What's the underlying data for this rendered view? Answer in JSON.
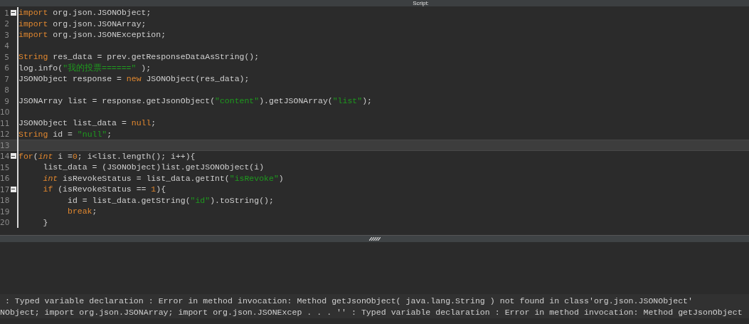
{
  "window": {
    "title": "Script:"
  },
  "editor": {
    "lines": [
      {
        "number": "1",
        "foldable": true,
        "current": false,
        "tokens": [
          {
            "kind": "keyword",
            "text": "import"
          },
          {
            "kind": "plain",
            "text": " org.json.JSONObject;"
          }
        ]
      },
      {
        "number": "2",
        "foldable": false,
        "current": false,
        "tokens": [
          {
            "kind": "keyword",
            "text": "import"
          },
          {
            "kind": "plain",
            "text": " org.json.JSONArray;"
          }
        ]
      },
      {
        "number": "3",
        "foldable": false,
        "current": false,
        "tokens": [
          {
            "kind": "keyword",
            "text": "import"
          },
          {
            "kind": "plain",
            "text": " org.json.JSONException;"
          }
        ]
      },
      {
        "number": "4",
        "foldable": false,
        "current": false
      },
      {
        "number": "5",
        "foldable": false,
        "current": false,
        "tokens": [
          {
            "kind": "keyword",
            "text": "String"
          },
          {
            "kind": "plain",
            "text": " res_data = prev.getResponseDataAsString();"
          }
        ]
      },
      {
        "number": "6",
        "foldable": false,
        "current": false,
        "tokens": [
          {
            "kind": "plain",
            "text": "log.info("
          },
          {
            "kind": "string",
            "text": "\"我的投票======\""
          },
          {
            "kind": "plain",
            "text": " );"
          }
        ]
      },
      {
        "number": "7",
        "foldable": false,
        "current": false,
        "tokens": [
          {
            "kind": "plain",
            "text": "JSONObject response = "
          },
          {
            "kind": "keyword",
            "text": "new"
          },
          {
            "kind": "plain",
            "text": " JSONObject(res_data);"
          }
        ]
      },
      {
        "number": "8",
        "foldable": false,
        "current": false
      },
      {
        "number": "9",
        "foldable": false,
        "current": false,
        "tokens": [
          {
            "kind": "plain",
            "text": "JSONArray list = response.getJsonObject("
          },
          {
            "kind": "string",
            "text": "\"content\""
          },
          {
            "kind": "plain",
            "text": ").getJSONArray("
          },
          {
            "kind": "string",
            "text": "\"list\""
          },
          {
            "kind": "plain",
            "text": ");"
          }
        ]
      },
      {
        "number": "10",
        "foldable": false,
        "current": false
      },
      {
        "number": "11",
        "foldable": false,
        "current": false,
        "tokens": [
          {
            "kind": "plain",
            "text": "JSONObject list_data = "
          },
          {
            "kind": "keyword",
            "text": "null"
          },
          {
            "kind": "plain",
            "text": ";"
          }
        ]
      },
      {
        "number": "12",
        "foldable": false,
        "current": false,
        "tokens": [
          {
            "kind": "keyword",
            "text": "String"
          },
          {
            "kind": "plain",
            "text": " id = "
          },
          {
            "kind": "string",
            "text": "\"null\""
          },
          {
            "kind": "plain",
            "text": ";"
          }
        ]
      },
      {
        "number": "13",
        "foldable": false,
        "current": true
      },
      {
        "number": "14",
        "foldable": true,
        "current": false,
        "tokens": [
          {
            "kind": "keyword",
            "text": "for"
          },
          {
            "kind": "plain",
            "text": "("
          },
          {
            "kind": "type",
            "text": "int"
          },
          {
            "kind": "plain",
            "text": " i ="
          },
          {
            "kind": "number",
            "text": "0"
          },
          {
            "kind": "plain",
            "text": "; i<list.length(); i++){"
          }
        ]
      },
      {
        "number": "15",
        "foldable": false,
        "current": false,
        "tokens": [
          {
            "kind": "plain",
            "text": "     list_data = (JSONObject)list.getJSONObject(i)"
          }
        ]
      },
      {
        "number": "16",
        "foldable": false,
        "current": false,
        "tokens": [
          {
            "kind": "type",
            "text": "     int"
          },
          {
            "kind": "plain",
            "text": " isRevokeStatus = list_data.getInt("
          },
          {
            "kind": "string",
            "text": "\"isRevoke\""
          },
          {
            "kind": "plain",
            "text": ")"
          }
        ]
      },
      {
        "number": "17",
        "foldable": true,
        "current": false,
        "tokens": [
          {
            "kind": "keyword",
            "text": "     if"
          },
          {
            "kind": "plain",
            "text": " (isRevokeStatus == "
          },
          {
            "kind": "number",
            "text": "1"
          },
          {
            "kind": "plain",
            "text": "){"
          }
        ]
      },
      {
        "number": "18",
        "foldable": false,
        "current": false,
        "tokens": [
          {
            "kind": "plain",
            "text": "          id = list_data.getString("
          },
          {
            "kind": "string",
            "text": "\"id\""
          },
          {
            "kind": "plain",
            "text": ").toString();"
          }
        ]
      },
      {
        "number": "19",
        "foldable": false,
        "current": false,
        "tokens": [
          {
            "kind": "keyword",
            "text": "          break"
          },
          {
            "kind": "plain",
            "text": ";"
          }
        ]
      },
      {
        "number": "20",
        "foldable": false,
        "current": false,
        "tokens": [
          {
            "kind": "plain",
            "text": "     }"
          }
        ]
      }
    ]
  },
  "output": {
    "lines": [
      " : Typed variable declaration : Error in method invocation: Method getJsonObject( java.lang.String ) not found in class'org.json.JSONObject'",
      "NObject; import org.json.JSONArray; import org.json.JSONExcep . . . '' : Typed variable declaration : Error in method invocation: Method getJsonObject"
    ]
  }
}
